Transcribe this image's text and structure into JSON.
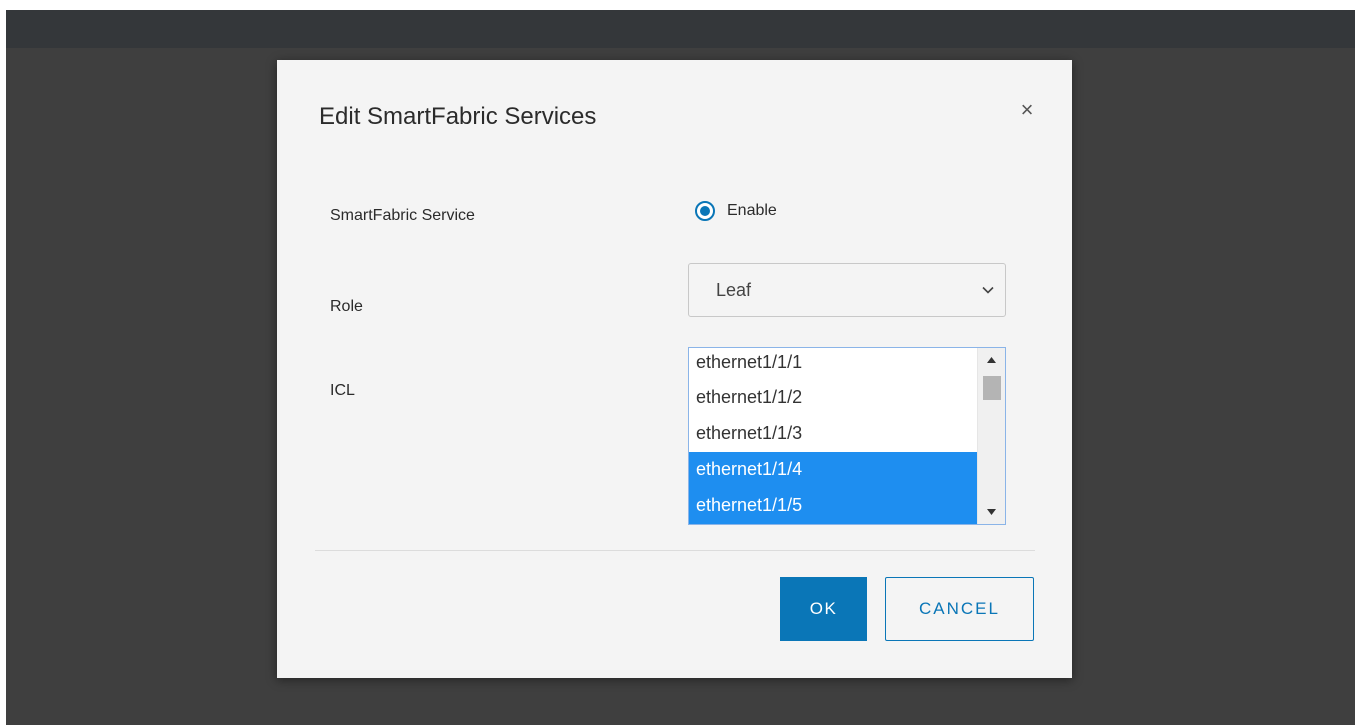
{
  "dialog": {
    "title": "Edit SmartFabric Services",
    "close_icon": "close-icon",
    "fields": {
      "smartfabric_service": {
        "label": "SmartFabric Service",
        "option_label": "Enable",
        "selected": true
      },
      "role": {
        "label": "Role",
        "value": "Leaf"
      },
      "icl": {
        "label": "ICL",
        "options": [
          {
            "label": "ethernet1/1/1",
            "selected": false
          },
          {
            "label": "ethernet1/1/2",
            "selected": false
          },
          {
            "label": "ethernet1/1/3",
            "selected": false
          },
          {
            "label": "ethernet1/1/4",
            "selected": true
          },
          {
            "label": "ethernet1/1/5",
            "selected": true
          }
        ]
      }
    },
    "buttons": {
      "ok_label": "OK",
      "cancel_label": "CANCEL"
    }
  },
  "colors": {
    "accent": "#0a76b7",
    "selection": "#1e8ef0",
    "backdrop": "#3f3f3f",
    "topbar": "#34373a",
    "dialog_bg": "#f4f4f4"
  }
}
